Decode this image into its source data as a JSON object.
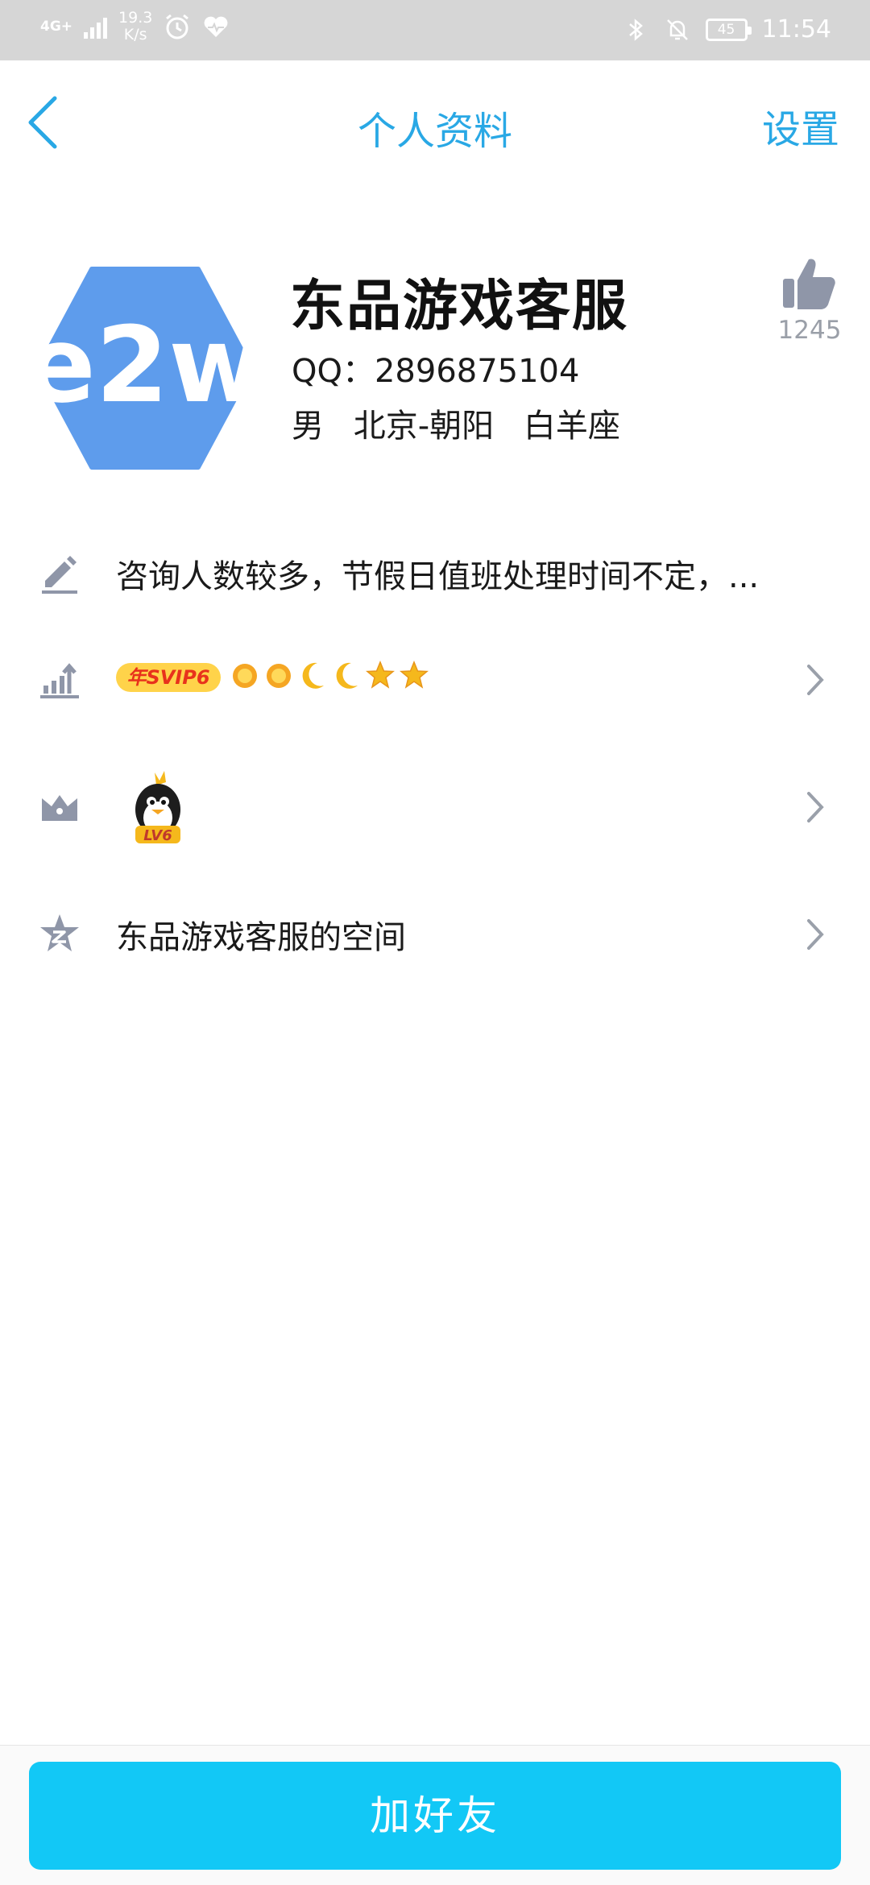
{
  "status_bar": {
    "network": "4G+",
    "speed_value": "19.3",
    "speed_unit": "K/s",
    "battery": "45",
    "time": "11:54"
  },
  "header": {
    "title": "个人资料",
    "settings_label": "设置"
  },
  "profile": {
    "avatar_logo_text": "e2w",
    "name": "东品游戏客服",
    "qq": "QQ：2896875104",
    "gender": "男",
    "location": "北京-朝阳",
    "zodiac": "白羊座",
    "like_count": "1245"
  },
  "rows": {
    "signature": "咨询人数较多，节假日值班处理时间不定，...",
    "svip_badge": "年SVIP6",
    "level_icons": [
      "sun-icon",
      "sun-icon",
      "moon-icon",
      "moon-icon",
      "star-icon",
      "star-icon"
    ],
    "penguin_level": "LV6",
    "qzone": "东品游戏客服的空间"
  },
  "bottom": {
    "add_friend_label": "加好友"
  },
  "colors": {
    "accent": "#29a8e5",
    "button": "#12c8f6",
    "icon_gray": "#8f96a8"
  }
}
